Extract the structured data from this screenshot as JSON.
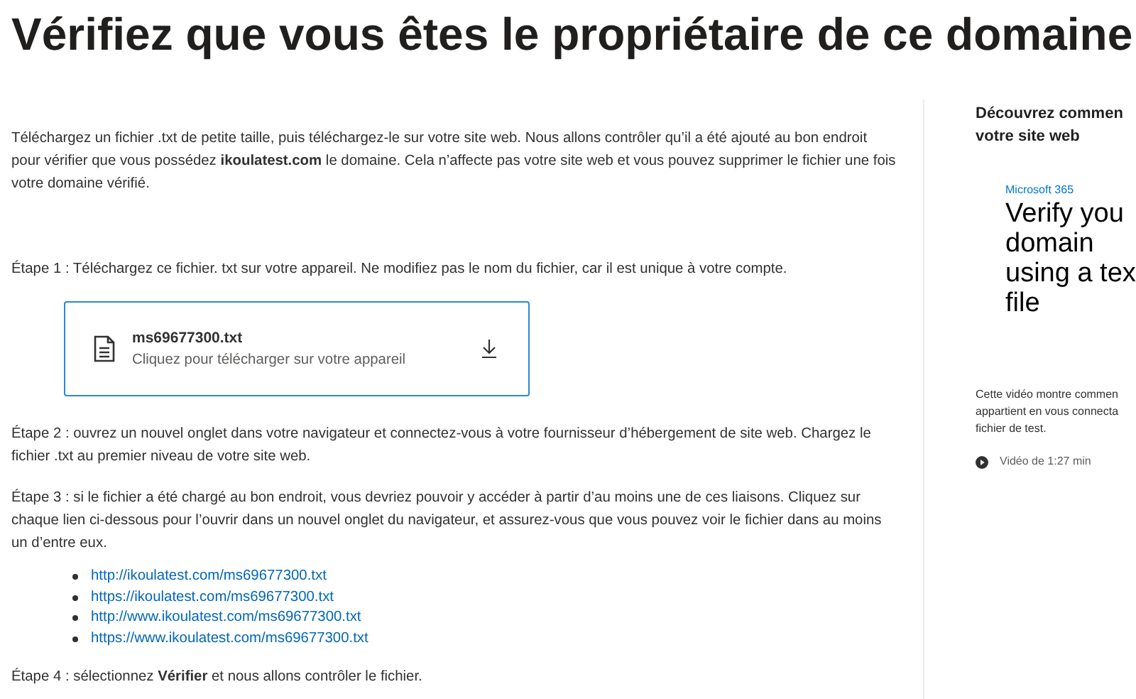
{
  "title": "Vérifiez que vous êtes le propriétaire de ce domaine",
  "intro": "Téléchargez un fichier .txt de petite taille, puis téléchargez-le sur votre site web. Nous allons contrôler qu’il a été ajouté au bon endroit pour vérifier que vous possédez **ikoulatest.com** le domaine. Cela n’affecte pas votre site web et vous pouvez supprimer le fichier une fois votre domaine vérifié.",
  "step1": "Étape 1 : Téléchargez ce fichier. txt sur votre appareil. Ne modifiez pas le nom du fichier, car il est unique à votre compte.",
  "download": {
    "filename": "ms69677300.txt",
    "hint": "Cliquez pour télécharger sur votre appareil"
  },
  "step2": "Étape 2 : ouvrez un nouvel onglet dans votre navigateur et connectez-vous à votre fournisseur d’hébergement de site web. Chargez le fichier .txt au premier niveau de votre site web.",
  "step3": "Étape 3 : si le fichier a été chargé au bon endroit, vous devriez pouvoir y accéder à partir d’au moins une de ces liaisons. Cliquez sur chaque lien ci-dessous pour l’ouvrir dans un nouvel onglet du navigateur, et assurez-vous que vous pouvez voir le fichier dans au moins un d’entre eux.",
  "links": [
    "http://ikoulatest.com/ms69677300.txt",
    "https://ikoulatest.com/ms69677300.txt",
    "http://www.ikoulatest.com/ms69677300.txt",
    "https://www.ikoulatest.com/ms69677300.txt"
  ],
  "step4": "Étape 4 : sélectionnez **Vérifier** et nous allons contrôler le fichier.",
  "sidebar": {
    "heading_lines": [
      "Découvrez commen",
      "votre site web"
    ],
    "video": {
      "brand": "Microsoft 365",
      "title_lines": [
        "Verify you",
        "domain",
        "using a tex",
        "file"
      ]
    },
    "description_lines": [
      "Cette vidéo montre commen",
      "appartient en vous connecta",
      "fichier de test."
    ],
    "duration": "Vidéo de 1:27 min"
  }
}
